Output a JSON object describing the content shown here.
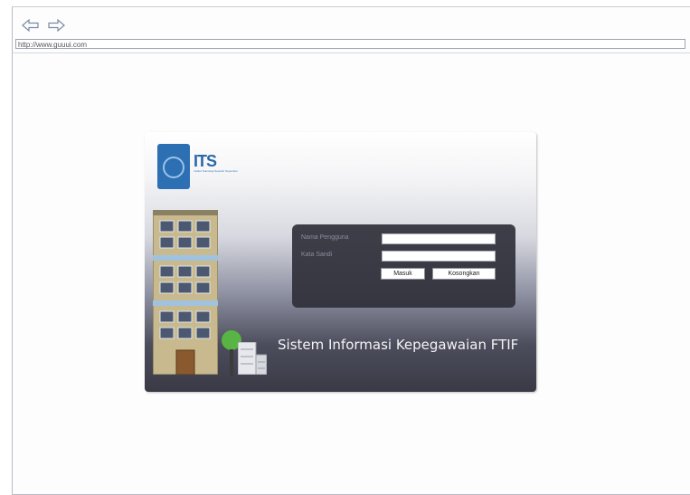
{
  "browser": {
    "url": "http://www.guuui.com",
    "back_icon": "back-arrow-icon",
    "forward_icon": "forward-arrow-icon"
  },
  "login_card": {
    "logo": {
      "text": "ITS",
      "subtext": "Institut Teknologi Sepuluh Nopember"
    },
    "username_label": "Nama Pengguna",
    "password_label": "Kata Sandi",
    "username_value": "",
    "password_value": "",
    "login_button": "Masuk",
    "clear_button": "Kosongkan",
    "system_title": "Sistem Informasi Kepegawaian FTIF"
  },
  "colors": {
    "panel": "#30303a",
    "logo_blue": "#2c6fb3",
    "card_dark": "#3a3a46"
  }
}
